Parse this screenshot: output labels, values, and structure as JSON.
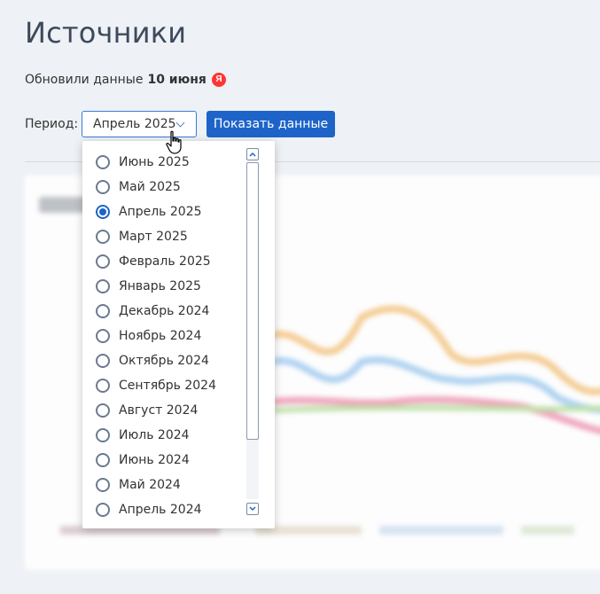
{
  "header": {
    "title": "Источники",
    "updated_prefix": "Обновили данные",
    "updated_date": "10 июня",
    "badge_letter": "Я"
  },
  "filters": {
    "period_label": "Период:",
    "period_selected": "Апрель 2025",
    "show_button": "Показать данные"
  },
  "dropdown": {
    "options": [
      {
        "label": "Июнь 2025",
        "checked": false
      },
      {
        "label": "Май 2025",
        "checked": false
      },
      {
        "label": "Апрель 2025",
        "checked": true
      },
      {
        "label": "Март 2025",
        "checked": false
      },
      {
        "label": "Февраль 2025",
        "checked": false
      },
      {
        "label": "Январь 2025",
        "checked": false
      },
      {
        "label": "Декабрь 2024",
        "checked": false
      },
      {
        "label": "Ноябрь 2024",
        "checked": false
      },
      {
        "label": "Октябрь 2024",
        "checked": false
      },
      {
        "label": "Сентябрь 2024",
        "checked": false
      },
      {
        "label": "Август 2024",
        "checked": false
      },
      {
        "label": "Июль 2024",
        "checked": false
      },
      {
        "label": "Июнь 2024",
        "checked": false
      },
      {
        "label": "Май 2024",
        "checked": false
      },
      {
        "label": "Апрель 2024",
        "checked": false
      }
    ]
  },
  "colors": {
    "accent": "#1e64c8",
    "title": "#3d4a5c",
    "badge": "#ff3333",
    "series": [
      "#f0a0b8",
      "#f5c98a",
      "#a8cff0",
      "#b8e0a0"
    ]
  }
}
